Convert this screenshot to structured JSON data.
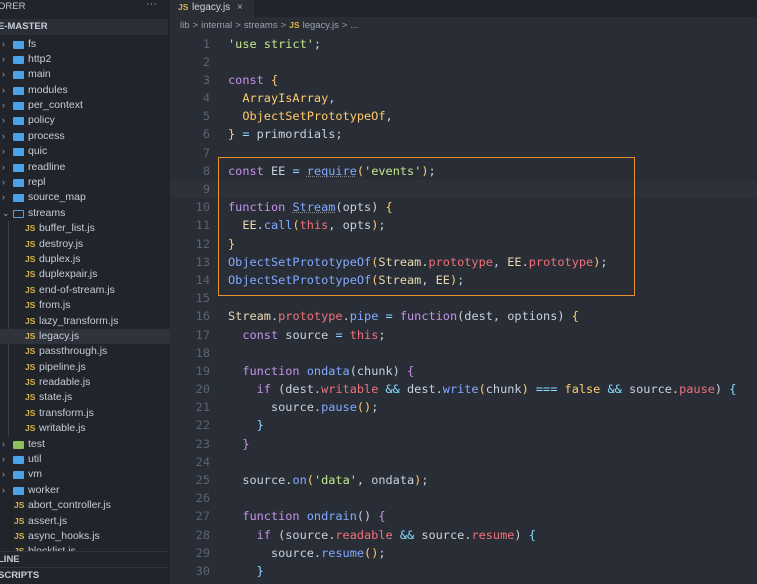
{
  "sidebar": {
    "title": "ORER",
    "more_icon": "ellipsis-icon",
    "root": "E-MASTER",
    "items": [
      {
        "type": "folder",
        "name": "fs",
        "depth": 0
      },
      {
        "type": "folder",
        "name": "http2",
        "depth": 0
      },
      {
        "type": "folder",
        "name": "main",
        "depth": 0
      },
      {
        "type": "folder",
        "name": "modules",
        "depth": 0
      },
      {
        "type": "folder",
        "name": "per_context",
        "depth": 0
      },
      {
        "type": "folder",
        "name": "policy",
        "depth": 0
      },
      {
        "type": "folder",
        "name": "process",
        "depth": 0
      },
      {
        "type": "folder",
        "name": "quic",
        "depth": 0
      },
      {
        "type": "folder",
        "name": "readline",
        "depth": 0
      },
      {
        "type": "folder",
        "name": "repl",
        "depth": 0
      },
      {
        "type": "folder",
        "name": "source_map",
        "depth": 0
      },
      {
        "type": "folder",
        "name": "streams",
        "depth": 0,
        "expanded": true
      },
      {
        "type": "file",
        "name": "buffer_list.js",
        "depth": 1
      },
      {
        "type": "file",
        "name": "destroy.js",
        "depth": 1
      },
      {
        "type": "file",
        "name": "duplex.js",
        "depth": 1
      },
      {
        "type": "file",
        "name": "duplexpair.js",
        "depth": 1
      },
      {
        "type": "file",
        "name": "end-of-stream.js",
        "depth": 1
      },
      {
        "type": "file",
        "name": "from.js",
        "depth": 1
      },
      {
        "type": "file",
        "name": "lazy_transform.js",
        "depth": 1
      },
      {
        "type": "file",
        "name": "legacy.js",
        "depth": 1,
        "selected": true
      },
      {
        "type": "file",
        "name": "passthrough.js",
        "depth": 1
      },
      {
        "type": "file",
        "name": "pipeline.js",
        "depth": 1
      },
      {
        "type": "file",
        "name": "readable.js",
        "depth": 1
      },
      {
        "type": "file",
        "name": "state.js",
        "depth": 1
      },
      {
        "type": "file",
        "name": "transform.js",
        "depth": 1
      },
      {
        "type": "file",
        "name": "writable.js",
        "depth": 1
      },
      {
        "type": "folder",
        "name": "test",
        "depth": 0,
        "special": "test"
      },
      {
        "type": "folder",
        "name": "util",
        "depth": 0
      },
      {
        "type": "folder",
        "name": "vm",
        "depth": 0
      },
      {
        "type": "folder",
        "name": "worker",
        "depth": 0
      },
      {
        "type": "file",
        "name": "abort_controller.js",
        "depth": 0
      },
      {
        "type": "file",
        "name": "assert.js",
        "depth": 0
      },
      {
        "type": "file",
        "name": "async_hooks.js",
        "depth": 0
      },
      {
        "type": "file",
        "name": "blocklist.js",
        "depth": 0
      }
    ],
    "js_badge": "JS",
    "outline": "LINE",
    "scripts": "SCRIPTS"
  },
  "tab": {
    "badge": "JS",
    "name": "legacy.js",
    "close": "×"
  },
  "breadcrumb": [
    "lib",
    ">",
    "internal",
    ">",
    "streams",
    ">",
    "JS",
    "legacy.js",
    ">",
    "..."
  ],
  "colors": {
    "highlight_box": "#e3922f",
    "keyword": "#c792ea",
    "string": "#c3e88d",
    "function": "#82aaff",
    "property": "#f07178",
    "operator": "#89ddff"
  },
  "code": [
    [
      [
        "'use strict'",
        "s"
      ],
      [
        ";",
        "v"
      ]
    ],
    [],
    [
      [
        "const",
        "k"
      ],
      [
        " {",
        "y"
      ]
    ],
    [
      [
        "  ArrayIsArray",
        "y"
      ],
      [
        ",",
        "v"
      ]
    ],
    [
      [
        "  ObjectSetPrototypeOf",
        "y"
      ],
      [
        ",",
        "v"
      ]
    ],
    [
      [
        "}",
        "y"
      ],
      [
        " = ",
        "o"
      ],
      [
        "primordials;",
        "v"
      ]
    ],
    [],
    [
      [
        "const",
        "k"
      ],
      [
        " EE ",
        "v"
      ],
      [
        "=",
        "o"
      ],
      [
        " ",
        "v"
      ],
      [
        "require",
        "f u"
      ],
      [
        "(",
        "y"
      ],
      [
        "'events'",
        "s"
      ],
      [
        ")",
        "y"
      ],
      [
        ";",
        "v"
      ]
    ],
    [],
    [
      [
        "function",
        "k"
      ],
      [
        " ",
        "v"
      ],
      [
        "Stream",
        "f u"
      ],
      [
        "(opts) ",
        "v"
      ],
      [
        "{",
        "y"
      ]
    ],
    [
      [
        "  EE",
        "c"
      ],
      [
        ".",
        "v"
      ],
      [
        "call",
        "f"
      ],
      [
        "(",
        "y"
      ],
      [
        "this",
        "p"
      ],
      [
        ", opts",
        ""
      ],
      [
        ")",
        "y"
      ],
      [
        ";",
        "v"
      ]
    ],
    [
      [
        "}",
        "y"
      ]
    ],
    [
      [
        "ObjectSetPrototypeOf",
        "f"
      ],
      [
        "(",
        "y"
      ],
      [
        "Stream",
        "c"
      ],
      [
        ".",
        "v"
      ],
      [
        "prototype",
        "p"
      ],
      [
        ", ",
        "v"
      ],
      [
        "EE",
        "c"
      ],
      [
        ".",
        "v"
      ],
      [
        "prototype",
        "p"
      ],
      [
        ")",
        "y"
      ],
      [
        ";",
        "v"
      ]
    ],
    [
      [
        "ObjectSetPrototypeOf",
        "f"
      ],
      [
        "(",
        "y"
      ],
      [
        "Stream",
        "c"
      ],
      [
        ", ",
        "v"
      ],
      [
        "EE",
        "c"
      ],
      [
        ")",
        "y"
      ],
      [
        ";",
        "v"
      ]
    ],
    [],
    [
      [
        "Stream",
        "c"
      ],
      [
        ".",
        "v"
      ],
      [
        "prototype",
        "p"
      ],
      [
        ".",
        "v"
      ],
      [
        "pipe",
        "f"
      ],
      [
        " = ",
        "o"
      ],
      [
        "function",
        "k"
      ],
      [
        "(dest, options) ",
        "v"
      ],
      [
        "{",
        "y"
      ]
    ],
    [
      [
        "  const",
        "k"
      ],
      [
        " source ",
        "v"
      ],
      [
        "=",
        "o"
      ],
      [
        " this",
        "p"
      ],
      [
        ";",
        "v"
      ]
    ],
    [],
    [
      [
        "  function",
        "k"
      ],
      [
        " ",
        "v"
      ],
      [
        "ondata",
        "f"
      ],
      [
        "(chunk) ",
        "v"
      ],
      [
        "{",
        "k"
      ]
    ],
    [
      [
        "    if",
        "k"
      ],
      [
        " (dest.",
        "v"
      ],
      [
        "writable",
        "p"
      ],
      [
        " && ",
        "o"
      ],
      [
        "dest.",
        "v"
      ],
      [
        "write",
        "f"
      ],
      [
        "(",
        "y"
      ],
      [
        "chunk",
        "v"
      ],
      [
        ")",
        "y"
      ],
      [
        " === ",
        "o"
      ],
      [
        "false",
        "y"
      ],
      [
        " && ",
        "o"
      ],
      [
        "source.",
        "v"
      ],
      [
        "pause",
        "p"
      ],
      [
        ") ",
        "v"
      ],
      [
        "{",
        "o"
      ]
    ],
    [
      [
        "      source.",
        "v"
      ],
      [
        "pause",
        "f"
      ],
      [
        "()",
        "y"
      ],
      [
        ";",
        "v"
      ]
    ],
    [
      [
        "    }",
        "o"
      ]
    ],
    [
      [
        "  }",
        "k"
      ]
    ],
    [],
    [
      [
        "  source.",
        "v"
      ],
      [
        "on",
        "f"
      ],
      [
        "(",
        "y"
      ],
      [
        "'data'",
        "s"
      ],
      [
        ", ondata",
        "v"
      ],
      [
        ")",
        "y"
      ],
      [
        ";",
        "v"
      ]
    ],
    [],
    [
      [
        "  function",
        "k"
      ],
      [
        " ",
        "v"
      ],
      [
        "ondrain",
        "f"
      ],
      [
        "() ",
        "v"
      ],
      [
        "{",
        "k"
      ]
    ],
    [
      [
        "    if",
        "k"
      ],
      [
        " (source.",
        "v"
      ],
      [
        "readable",
        "p"
      ],
      [
        " && ",
        "o"
      ],
      [
        "source.",
        "v"
      ],
      [
        "resume",
        "p"
      ],
      [
        ") ",
        "v"
      ],
      [
        "{",
        "o"
      ]
    ],
    [
      [
        "      source.",
        "v"
      ],
      [
        "resume",
        "f"
      ],
      [
        "()",
        "y"
      ],
      [
        ";",
        "v"
      ]
    ],
    [
      [
        "    }",
        "o"
      ]
    ]
  ]
}
